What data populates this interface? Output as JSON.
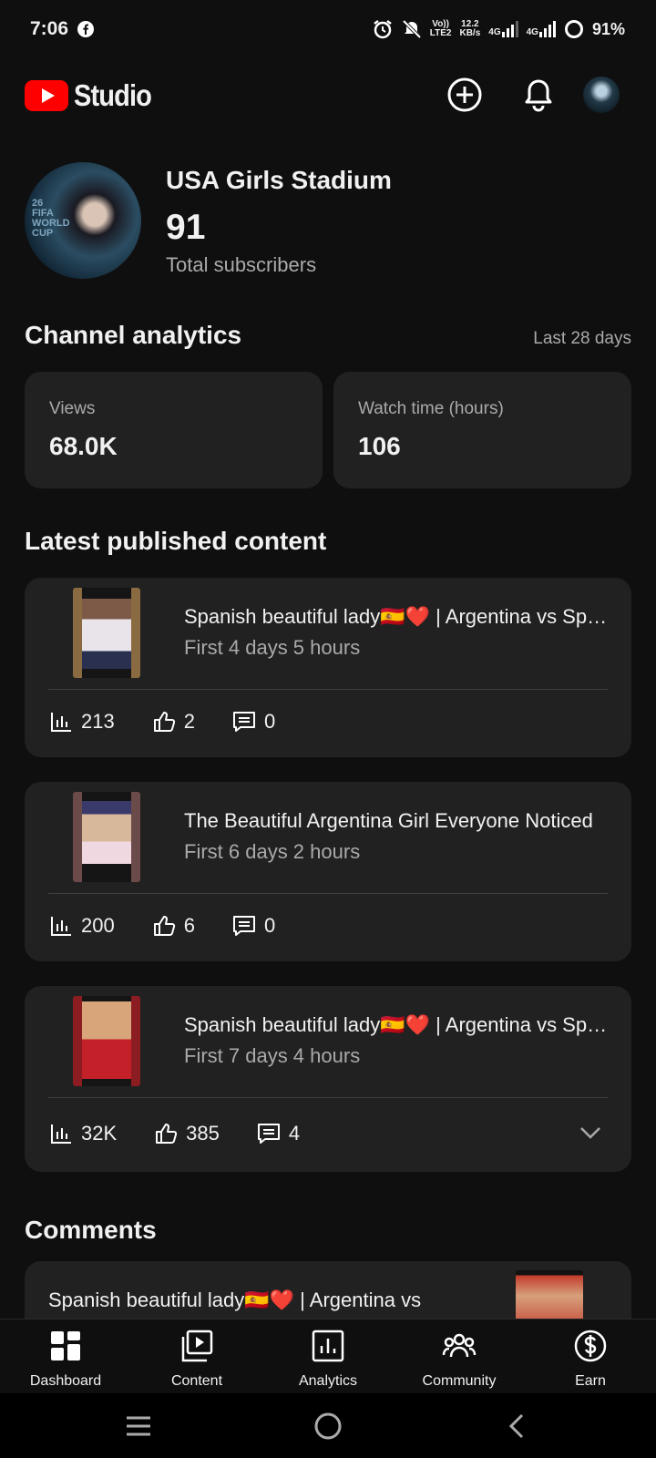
{
  "status_bar": {
    "time": "7:06",
    "lte": "LTE2",
    "volte": "Vo))",
    "speed": "12.2",
    "speed_unit": "KB/s",
    "net1": "4G",
    "net2": "4G",
    "battery": "91%"
  },
  "app_bar": {
    "logo_text": "Studio"
  },
  "channel": {
    "name": "USA Girls Stadium",
    "subscriber_count": "91",
    "subscriber_label": "Total subscribers",
    "avatar_text": "26 FIFA WORLD CUP"
  },
  "analytics": {
    "title": "Channel analytics",
    "range": "Last 28 days",
    "views_label": "Views",
    "views_value": "68.0K",
    "watch_label": "Watch time (hours)",
    "watch_value": "106"
  },
  "latest": {
    "title": "Latest published content",
    "videos": [
      {
        "title": "Spanish beautiful lady🇪🇸❤️ | Argentina vs Spain",
        "age": "First 4 days 5 hours",
        "views": "213",
        "likes": "2",
        "comments": "0"
      },
      {
        "title": "The Beautiful Argentina Girl Everyone Noticed",
        "age": "First 6 days 2 hours",
        "views": "200",
        "likes": "6",
        "comments": "0"
      },
      {
        "title": "Spanish beautiful lady🇪🇸❤️ | Argentina vs Spain",
        "age": "First 7 days 4 hours",
        "views": "32K",
        "likes": "385",
        "comments": "4"
      }
    ]
  },
  "comments": {
    "title": "Comments",
    "first_title": "Spanish beautiful lady🇪🇸❤️ | Argentina vs"
  },
  "bottom_nav": {
    "items": [
      {
        "label": "Dashboard",
        "icon": "dashboard-icon"
      },
      {
        "label": "Content",
        "icon": "content-icon"
      },
      {
        "label": "Analytics",
        "icon": "analytics-icon"
      },
      {
        "label": "Community",
        "icon": "community-icon"
      },
      {
        "label": "Earn",
        "icon": "earn-icon"
      }
    ]
  },
  "colors": {
    "background": "#0f0f0f",
    "card": "#212121",
    "brand_red": "#ff0000",
    "secondary_text": "#aaaaaa"
  }
}
